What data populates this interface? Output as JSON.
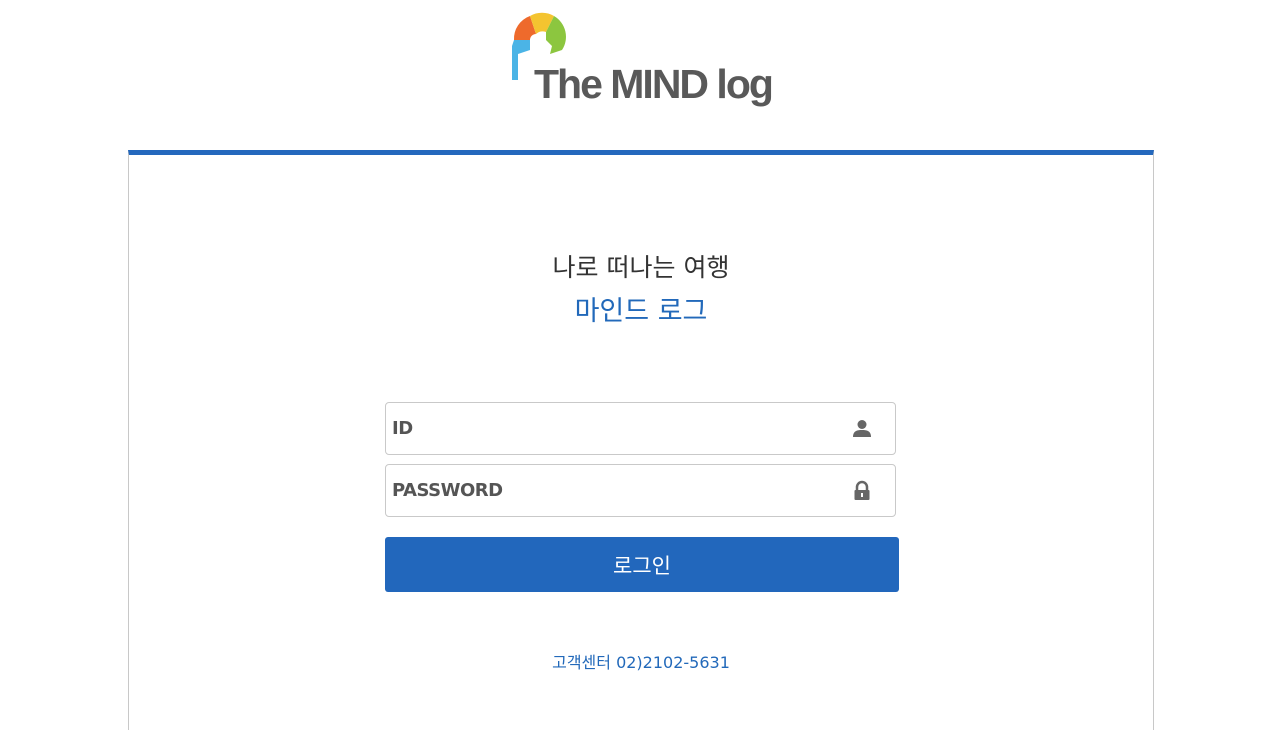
{
  "logo": {
    "text": "The MIND log",
    "colors": {
      "orange": "#ee6a2c",
      "yellow": "#f4c430",
      "green": "#8cc63f",
      "blue": "#4bb4e6",
      "text": "#595959"
    }
  },
  "header_bar_color": "#2468bd",
  "tagline": "나로 떠나는 여행",
  "brand": "마인드 로그",
  "form": {
    "id_placeholder": "ID",
    "password_placeholder": "PASSWORD",
    "id_icon": "user-icon",
    "password_icon": "lock-icon",
    "login_label": "로그인",
    "login_color": "#2267bc"
  },
  "support": "고객센터 02)2102-5631"
}
